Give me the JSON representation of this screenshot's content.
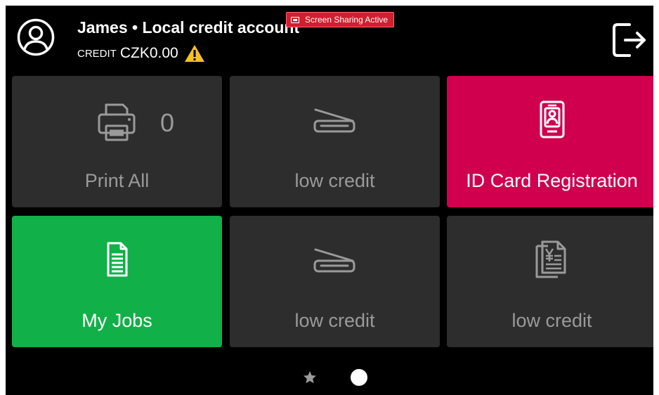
{
  "header": {
    "user_line": "James • Local credit account",
    "credit_label": "CREDIT",
    "credit_value": "CZK0.00",
    "warning_icon": "warning-icon",
    "logout_icon": "logout-icon",
    "avatar_icon": "user-avatar-icon"
  },
  "screen_share": {
    "label": "Screen Sharing Active",
    "color": "#d01f2e"
  },
  "tiles": [
    {
      "label": "Print All",
      "count": "0",
      "icon": "printer-icon",
      "color": "#2d2d2d"
    },
    {
      "label": "low credit",
      "icon": "scanner-icon",
      "color": "#2d2d2d"
    },
    {
      "label": "ID Card Registration",
      "icon": "id-card-icon",
      "color": "#d0004f"
    },
    {
      "label": "My Jobs",
      "icon": "document-icon",
      "color": "#12b048"
    },
    {
      "label": "low credit",
      "icon": "scanner-icon",
      "color": "#2d2d2d"
    },
    {
      "label": "low credit",
      "icon": "priced-documents-icon",
      "color": "#2d2d2d"
    }
  ],
  "pager": {
    "items": [
      "favorites-star-icon",
      "page-dot"
    ],
    "active_index": 1
  }
}
